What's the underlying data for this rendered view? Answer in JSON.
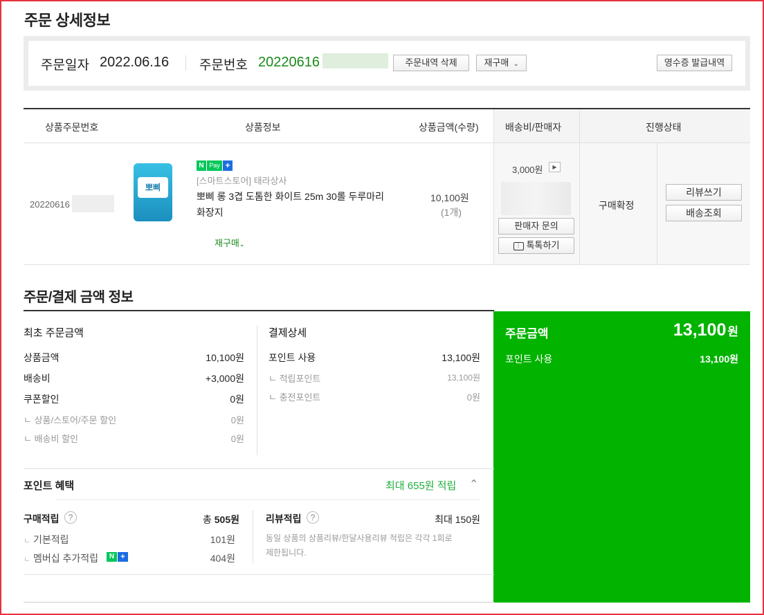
{
  "page_title": "주문 상세정보",
  "summary": {
    "order_date_label": "주문일자",
    "order_date": "2022.06.16",
    "order_no_label": "주문번호",
    "order_no": "20220616",
    "delete_btn": "주문내역 삭제",
    "reorder_btn": "재구매",
    "receipt_btn": "영수증 발급내역"
  },
  "table": {
    "headers": {
      "product_order_no": "상품주문번호",
      "product_info": "상품정보",
      "price_qty": "상품금액(수량)",
      "shipping_seller": "배송비/판매자",
      "status": "진행상태"
    },
    "row": {
      "product_order_no": "20220616",
      "npay_n": "N",
      "npay_pay": "Pay",
      "npay_plus": "+",
      "store": "[스마트스토어] 태라상사",
      "name_line1": "뽀삐 롱 3겹 도톰한 화이트 25m 30롤 두루마리",
      "name_line2": "화장지",
      "image_label": "뽀삐",
      "reorder": "재구매",
      "price": "10,100원",
      "qty": "(1개)",
      "shipping_fee": "3,000원",
      "seller_inquiry_btn": "판매자 문의",
      "talk_btn": "톡톡하기",
      "status": "구매확정",
      "review_btn": "리뷰쓰기",
      "tracking_btn": "배송조회"
    }
  },
  "payment": {
    "section_title": "주문/결제 금액 정보",
    "initial": {
      "title": "최초 주문금액",
      "product_amount_label": "상품금액",
      "product_amount": "10,100원",
      "shipping_label": "배송비",
      "shipping": "+3,000원",
      "coupon_label": "쿠폰할인",
      "coupon": "0원",
      "store_discount_label": "ㄴ 상품/스토어/주문 할인",
      "store_discount": "0원",
      "shipping_discount_label": "ㄴ 배송비 할인",
      "shipping_discount": "0원"
    },
    "detail": {
      "title": "결제상세",
      "point_use_label": "포인트 사용",
      "point_use": "13,100원",
      "earned_point_label": "ㄴ 적립포인트",
      "earned_point": "13,100원",
      "charged_point_label": "ㄴ 충전포인트",
      "charged_point": "0원"
    },
    "summary": {
      "order_amount_label": "주문금액",
      "order_amount_num": "13,100",
      "order_amount_unit": "원",
      "point_use_label": "포인트 사용",
      "point_use": "13,100원"
    }
  },
  "benefit": {
    "title": "포인트 혜택",
    "max_label": "최대 655원 적립",
    "purchase": {
      "label": "구매적립",
      "total_prefix": "총",
      "total": "505원",
      "basic_label": "기본적립",
      "basic": "101원",
      "membership_label": "멤버십 추가적립",
      "membership": "404원"
    },
    "review": {
      "label": "리뷰적립",
      "max": "최대 150원",
      "desc_line1": "동일 상품의 상품리뷰/한달사용리뷰 적립은 각각 1회로",
      "desc_line2": "제한됩니다."
    }
  },
  "colors": {
    "accent_green": "#02b300",
    "order_no_green": "#1a8a1a",
    "border_red": "#e5323c"
  }
}
